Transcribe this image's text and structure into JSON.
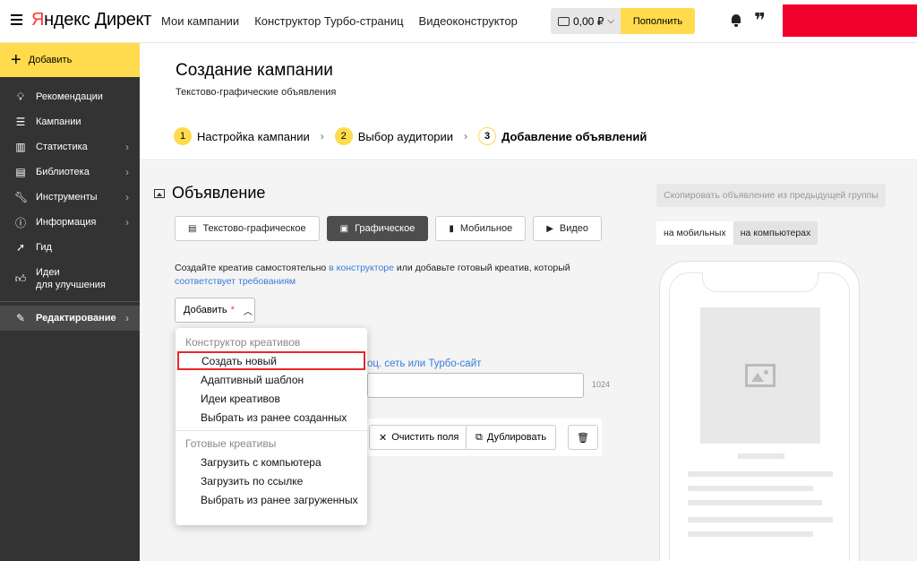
{
  "header": {
    "logo_prefix": "Я",
    "logo_rest": "ндекс Директ",
    "nav": [
      "Мои кампании",
      "Конструктор Турбо-страниц",
      "Видеоконструктор"
    ],
    "balance": "0,00 ₽",
    "topup_label": "Пополнить"
  },
  "sidebar": {
    "add_label": "Добавить",
    "items": [
      {
        "label": "Рекомендации",
        "icon": "lightbulb-icon"
      },
      {
        "label": "Кампании",
        "icon": "list-icon"
      },
      {
        "label": "Статистика",
        "icon": "bar-chart-icon"
      },
      {
        "label": "Библиотека",
        "icon": "library-icon"
      },
      {
        "label": "Инструменты",
        "icon": "wrench-icon"
      },
      {
        "label": "Информация",
        "icon": "info-icon"
      },
      {
        "label": "Гид",
        "icon": "guide-icon"
      },
      {
        "label": "Идеи",
        "label2": "для улучшения",
        "icon": "thumbs-up-icon"
      },
      {
        "label": "Редактирование",
        "icon": "pencil-icon"
      }
    ]
  },
  "page": {
    "title": "Создание кампании",
    "subtitle": "Текстово-графические объявления",
    "steps": [
      {
        "num": "1",
        "label": "Настройка кампании"
      },
      {
        "num": "2",
        "label": "Выбор аудитории"
      },
      {
        "num": "3",
        "label": "Добавление объявлений"
      }
    ]
  },
  "ad": {
    "title": "Объявление",
    "types": [
      "Текстово-графическое",
      "Графическое",
      "Мобильное",
      "Видео"
    ],
    "desc_1": "Создайте креатив самостоятельно ",
    "desc_link1": "в конструкторе",
    "desc_2": " или добавьте готовый креатив, который",
    "desc_link2": "соответствует требованиям",
    "add_label": "Добавить",
    "add_required": "*",
    "field_link": "оц. сеть или Турбо-сайт",
    "counter": "1024",
    "clear_label": "Очистить поля",
    "duplicate_label": "Дублировать"
  },
  "dropdown": {
    "group1": "Конструктор креативов",
    "group1_items": [
      "Создать новый",
      "Адаптивный шаблон",
      "Идеи креативов",
      "Выбрать из ранее созданных"
    ],
    "group2": "Готовые креативы",
    "group2_items": [
      "Загрузить с компьютера",
      "Загрузить по ссылке",
      "Выбрать из ранее загруженных"
    ]
  },
  "preview": {
    "copy_label": "Скопировать объявление из предыдущей группы",
    "tabs": [
      "на мобильных",
      "на компьютерах"
    ]
  }
}
